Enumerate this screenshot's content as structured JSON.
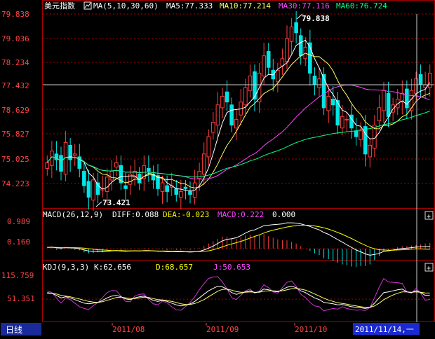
{
  "main_panel": {
    "title": "美元指数",
    "ma_label": "MA(5,10,30,60)",
    "ma5": "MA5:77.333",
    "ma10": "MA10:77.214",
    "ma30": "MA30:77.116",
    "ma60": "MA60:76.724",
    "high_label": "79.838",
    "low_label": "73.421",
    "axis_ticks": [
      "79.838",
      "79.036",
      "78.234",
      "77.432",
      "78.629",
      "75.827",
      "75.025",
      "74.223"
    ]
  },
  "macd_panel": {
    "label": "MACD(26,12,9)",
    "diff": "DIFF:0.088",
    "dea": "DEA:-0.023",
    "macd": "MACD:0.222",
    "extra": "0.000",
    "axis_ticks": [
      "0.989",
      "0.160"
    ],
    "expand_button": "+"
  },
  "kdj_panel": {
    "label": "KDJ(9,3,3)",
    "k": "K:62.656",
    "d": "D:68.657",
    "j": "J:50.653",
    "axis_ticks": [
      "115.759",
      "51.351"
    ],
    "expand_button": "+"
  },
  "bottom_bar": {
    "period": "日线",
    "date_ticks": [
      "2011/08",
      "2011/09",
      "2011/10"
    ],
    "cursor_date": "2011/11/14,一"
  },
  "colors": {
    "rise": "#ff3c3c",
    "fall": "#00e5e5",
    "ma5": "#ffffff",
    "ma10": "#ffff66",
    "ma30": "#ff44ff",
    "ma60": "#00ff88",
    "grid": "#aa0000",
    "dea": "#ffff00"
  },
  "chart_data": [
    {
      "type": "candlestick",
      "title": "美元指数",
      "x_range": [
        "2011-07",
        "2011-11-14"
      ],
      "ylim": [
        73.4,
        80.0
      ],
      "price_high": 79.838,
      "price_low": 73.421,
      "series": [
        {
          "name": "MA5",
          "last": 77.333
        },
        {
          "name": "MA10",
          "last": 77.214
        },
        {
          "name": "MA30",
          "last": 77.116
        },
        {
          "name": "MA60",
          "last": 76.724
        }
      ],
      "close": [
        74.9,
        75.3,
        75.0,
        74.6,
        75.6,
        75.0,
        75.2,
        74.7,
        74.1,
        73.7,
        74.3,
        73.8,
        74.0,
        74.4,
        74.6,
        74.9,
        74.2,
        74.0,
        74.5,
        74.6,
        74.2,
        74.8,
        74.6,
        74.3,
        74.0,
        74.2,
        73.9,
        74.1,
        73.8,
        73.9,
        74.0,
        73.8,
        74.2,
        74.6,
        75.2,
        75.8,
        76.3,
        76.9,
        77.2,
        77.0,
        76.2,
        76.4,
        77.0,
        77.5,
        77.9,
        77.1,
        78.0,
        78.6,
        78.2,
        77.8,
        78.1,
        78.5,
        79.2,
        79.6,
        79.4,
        78.6,
        78.9,
        78.0,
        77.6,
        77.8,
        76.8,
        77.2,
        76.9,
        76.2,
        76.5,
        76.4,
        76.1,
        75.8,
        76.0,
        75.2,
        75.5,
        76.2,
        76.8,
        77.4,
        76.5,
        76.9,
        77.1,
        77.3,
        76.8,
        77.4,
        77.8,
        77.6,
        77.6,
        78.0
      ]
    },
    {
      "type": "line",
      "title": "MACD(26,12,9)",
      "ylim": [
        -0.4,
        1.1
      ],
      "series": [
        {
          "name": "DIFF",
          "last": 0.088
        },
        {
          "name": "DEA",
          "last": -0.023
        },
        {
          "name": "MACD",
          "last": 0.222
        }
      ],
      "values": [
        0.05,
        0.06,
        0.03,
        0.02,
        0.04,
        0.03,
        0.02,
        0.0,
        -0.05,
        -0.09,
        -0.1,
        -0.11,
        -0.12,
        -0.1,
        -0.08,
        -0.07,
        -0.09,
        -0.1,
        -0.09,
        -0.08,
        -0.09,
        -0.07,
        -0.07,
        -0.08,
        -0.1,
        -0.1,
        -0.11,
        -0.11,
        -0.12,
        -0.12,
        -0.12,
        -0.13,
        -0.12,
        -0.1,
        -0.05,
        0.02,
        0.1,
        0.2,
        0.3,
        0.36,
        0.38,
        0.42,
        0.5,
        0.6,
        0.68,
        0.72,
        0.8,
        0.88,
        0.9,
        0.92,
        0.93,
        0.95,
        0.99,
        0.99,
        0.98,
        0.95,
        0.9,
        0.85,
        0.78,
        0.72,
        0.62,
        0.55,
        0.45,
        0.35,
        0.25,
        0.15,
        0.05,
        -0.05,
        -0.12,
        -0.2,
        -0.25,
        -0.22,
        -0.18,
        -0.1,
        -0.08,
        -0.05,
        -0.02,
        0.01,
        0.02,
        0.04,
        0.06,
        0.07,
        0.08,
        0.088
      ],
      "dea_values": [
        0.05,
        0.05,
        0.05,
        0.04,
        0.04,
        0.04,
        0.04,
        0.03,
        0.02,
        0.0,
        -0.02,
        -0.04,
        -0.05,
        -0.06,
        -0.07,
        -0.07,
        -0.07,
        -0.08,
        -0.08,
        -0.08,
        -0.08,
        -0.08,
        -0.08,
        -0.08,
        -0.09,
        -0.09,
        -0.09,
        -0.1,
        -0.1,
        -0.1,
        -0.11,
        -0.11,
        -0.11,
        -0.11,
        -0.1,
        -0.08,
        -0.04,
        0.01,
        0.07,
        0.13,
        0.18,
        0.23,
        0.28,
        0.34,
        0.41,
        0.47,
        0.53,
        0.6,
        0.66,
        0.71,
        0.75,
        0.79,
        0.83,
        0.86,
        0.88,
        0.9,
        0.9,
        0.89,
        0.87,
        0.84,
        0.8,
        0.75,
        0.69,
        0.62,
        0.55,
        0.47,
        0.39,
        0.3,
        0.21,
        0.13,
        0.05,
        0.0,
        -0.04,
        -0.05,
        -0.06,
        -0.06,
        -0.05,
        -0.04,
        -0.03,
        -0.02,
        -0.01,
        -0.01,
        -0.02,
        -0.023
      ]
    },
    {
      "type": "line",
      "title": "KDJ(9,3,3)",
      "ylim": [
        -10,
        125
      ],
      "series": [
        {
          "name": "K",
          "last": 62.656
        },
        {
          "name": "D",
          "last": 68.657
        },
        {
          "name": "J",
          "last": 50.653
        }
      ],
      "k_values": [
        70,
        68,
        62,
        55,
        58,
        55,
        50,
        45,
        40,
        38,
        40,
        42,
        48,
        55,
        60,
        62,
        58,
        52,
        50,
        55,
        58,
        60,
        54,
        48,
        45,
        48,
        45,
        40,
        35,
        32,
        34,
        38,
        45,
        55,
        65,
        75,
        82,
        88,
        86,
        80,
        70,
        65,
        68,
        72,
        75,
        70,
        72,
        80,
        78,
        74,
        72,
        78,
        85,
        88,
        84,
        75,
        70,
        62,
        55,
        50,
        42,
        40,
        38,
        35,
        36,
        33,
        30,
        28,
        27,
        25,
        28,
        40,
        55,
        70,
        72,
        75,
        78,
        80,
        72,
        70,
        75,
        70,
        62,
        62.656
      ],
      "d_values": [
        68,
        68,
        66,
        62,
        60,
        58,
        55,
        52,
        48,
        45,
        43,
        42,
        44,
        48,
        52,
        56,
        57,
        55,
        53,
        53,
        55,
        57,
        56,
        53,
        50,
        49,
        47,
        45,
        42,
        38,
        36,
        36,
        39,
        44,
        50,
        58,
        66,
        74,
        79,
        80,
        77,
        73,
        71,
        71,
        72,
        71,
        71,
        74,
        75,
        75,
        74,
        75,
        78,
        81,
        82,
        80,
        77,
        72,
        66,
        60,
        54,
        49,
        45,
        41,
        39,
        37,
        34,
        32,
        30,
        28,
        28,
        32,
        40,
        50,
        57,
        63,
        68,
        72,
        72,
        71,
        72,
        71,
        69,
        68.657
      ],
      "j_values": [
        75,
        70,
        55,
        40,
        55,
        50,
        40,
        30,
        25,
        22,
        33,
        42,
        56,
        70,
        76,
        75,
        60,
        45,
        44,
        60,
        65,
        66,
        50,
        38,
        35,
        46,
        41,
        30,
        21,
        20,
        30,
        42,
        58,
        78,
        95,
        110,
        114,
        115,
        100,
        80,
        56,
        50,
        62,
        75,
        80,
        68,
        74,
        92,
        84,
        72,
        68,
        84,
        99,
        103,
        88,
        65,
        56,
        42,
        32,
        30,
        18,
        22,
        25,
        23,
        30,
        25,
        22,
        20,
        21,
        19,
        28,
        56,
        85,
        110,
        100,
        99,
        98,
        96,
        72,
        68,
        82,
        68,
        48,
        50.653
      ]
    }
  ]
}
